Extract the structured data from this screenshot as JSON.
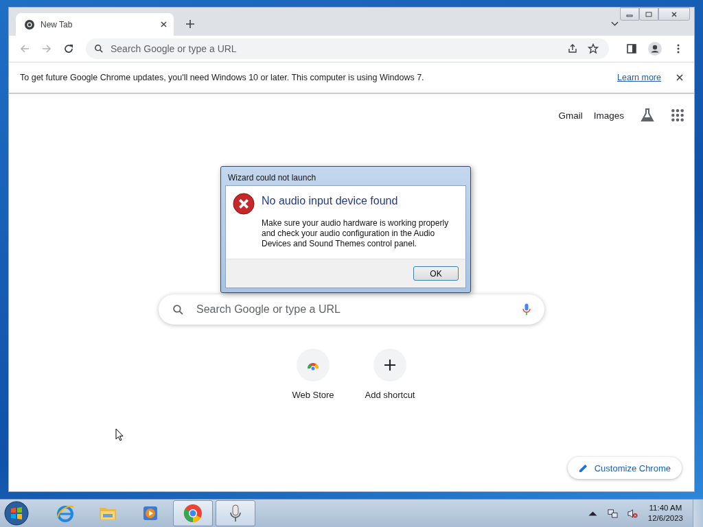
{
  "browser": {
    "tabs": [
      {
        "title": "New Tab",
        "selected": true
      }
    ],
    "address_bar": {
      "placeholder": "Search Google or type a URL"
    },
    "infobar": {
      "message": "To get future Google Chrome updates, you'll need Windows 10 or later. This computer is using Windows 7.",
      "link": "Learn more"
    },
    "header_links": [
      "Gmail",
      "Images"
    ],
    "search": {
      "placeholder": "Search Google or type a URL"
    },
    "shortcuts": [
      {
        "kind": "store",
        "label": "Web Store"
      },
      {
        "kind": "add",
        "label": "Add shortcut"
      }
    ],
    "customize_button": "Customize Chrome"
  },
  "dialog": {
    "title": "Wizard could not launch",
    "heading": "No audio input device found",
    "message": "Make sure your audio hardware is working properly and check your audio configuration in the Audio Devices and Sound Themes control panel.",
    "button": "OK"
  },
  "taskbar": {
    "items": [
      {
        "kind": "ie",
        "selected": false
      },
      {
        "kind": "explorer",
        "selected": false
      },
      {
        "kind": "media",
        "selected": false
      },
      {
        "kind": "chrome",
        "selected": true
      },
      {
        "kind": "mic",
        "selected": true
      }
    ],
    "time": "11:40 AM",
    "date": "12/6/2023"
  }
}
